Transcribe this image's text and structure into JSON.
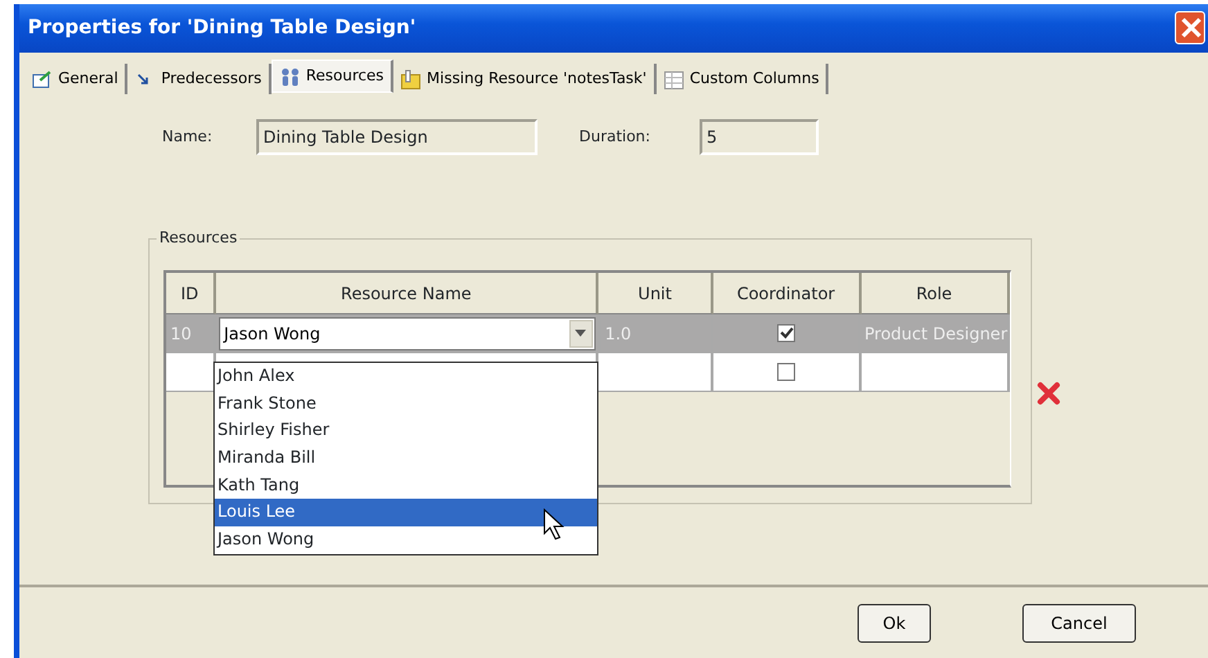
{
  "window": {
    "title": "Properties for 'Dining Table Design'"
  },
  "tabs": [
    {
      "label": "General",
      "kind": "general",
      "selected": false
    },
    {
      "label": "Predecessors",
      "kind": "arrow",
      "selected": false
    },
    {
      "label": "Resources",
      "kind": "people",
      "selected": true
    },
    {
      "label": "Missing Resource 'notesTask'",
      "kind": "folder",
      "selected": false
    },
    {
      "label": "Custom Columns",
      "kind": "table",
      "selected": false
    }
  ],
  "fields": [
    {
      "label": "Name:",
      "value": "Dining Table Design"
    },
    {
      "label": "Duration:",
      "value": "5"
    }
  ],
  "resources": {
    "legend": "Resources",
    "columns": [
      "ID",
      "Resource Name",
      "Unit",
      "Coordinator",
      "Role"
    ],
    "rows": [
      {
        "id": "10",
        "resource_name": "Jason Wong",
        "unit": "1.0",
        "coordinator": true,
        "role": "Product Designer",
        "selected": true
      },
      {
        "coordinator": false,
        "selected": false
      }
    ],
    "dropdown": [
      {
        "label": "John Alex",
        "selected": false
      },
      {
        "label": "Frank Stone",
        "selected": false
      },
      {
        "label": "Shirley Fisher",
        "selected": false
      },
      {
        "label": "Miranda Bill",
        "selected": false
      },
      {
        "label": "Kath Tang",
        "selected": false
      },
      {
        "label": "Louis Lee",
        "selected": true
      },
      {
        "label": "Jason Wong",
        "selected": false
      }
    ]
  },
  "buttons": [
    "Ok",
    "Cancel"
  ]
}
